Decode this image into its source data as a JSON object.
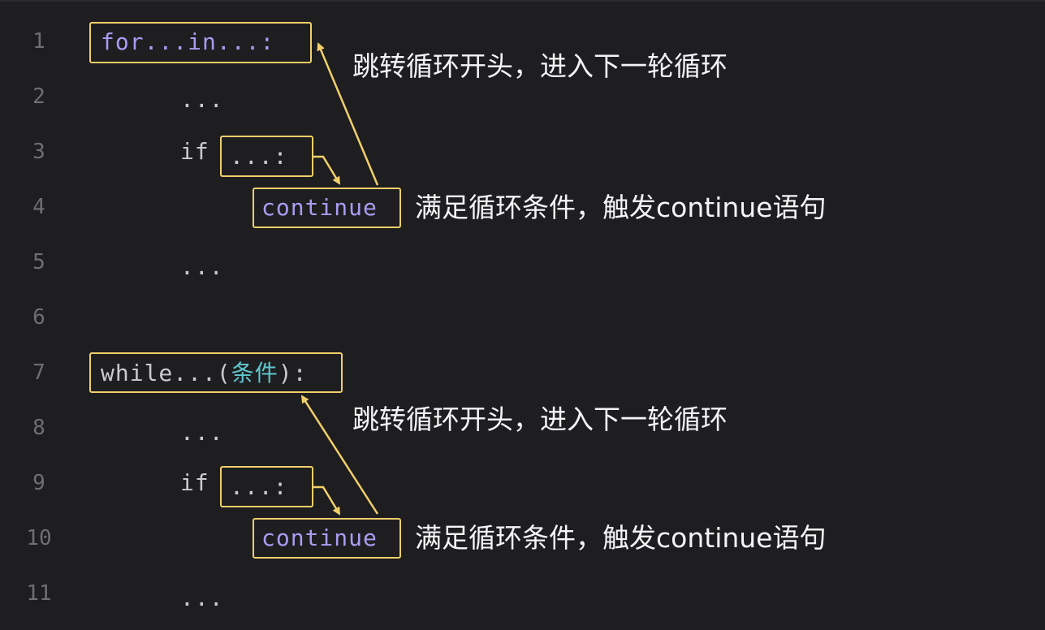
{
  "line_numbers": [
    "1",
    "2",
    "3",
    "4",
    "5",
    "6",
    "7",
    "8",
    "9",
    "10",
    "11"
  ],
  "code": {
    "line1": "for...in...:",
    "line2": "...",
    "line3_kw": "if",
    "line3_cond": "...:",
    "line4": "continue",
    "line5": "...",
    "line7_pre": "while...(",
    "line7_cn": "条件",
    "line7_post": "):",
    "line8": "...",
    "line9_kw": "if",
    "line9_cond": "...:",
    "line10": "continue",
    "line11": "..."
  },
  "notes": {
    "jump_1": "跳转循环开头，进入下一轮循环",
    "trigger_1": "满足循环条件，触发continue语句",
    "jump_2": "跳转循环开头，进入下一轮循环",
    "trigger_2": "满足循环条件，触发continue语句"
  },
  "colors": {
    "background": "#1e1e20",
    "highlight_box": "#f1cf6a",
    "keyword": "#a99cf2",
    "chinese_token": "#5fc7cf",
    "line_number": "#6e6e74"
  }
}
